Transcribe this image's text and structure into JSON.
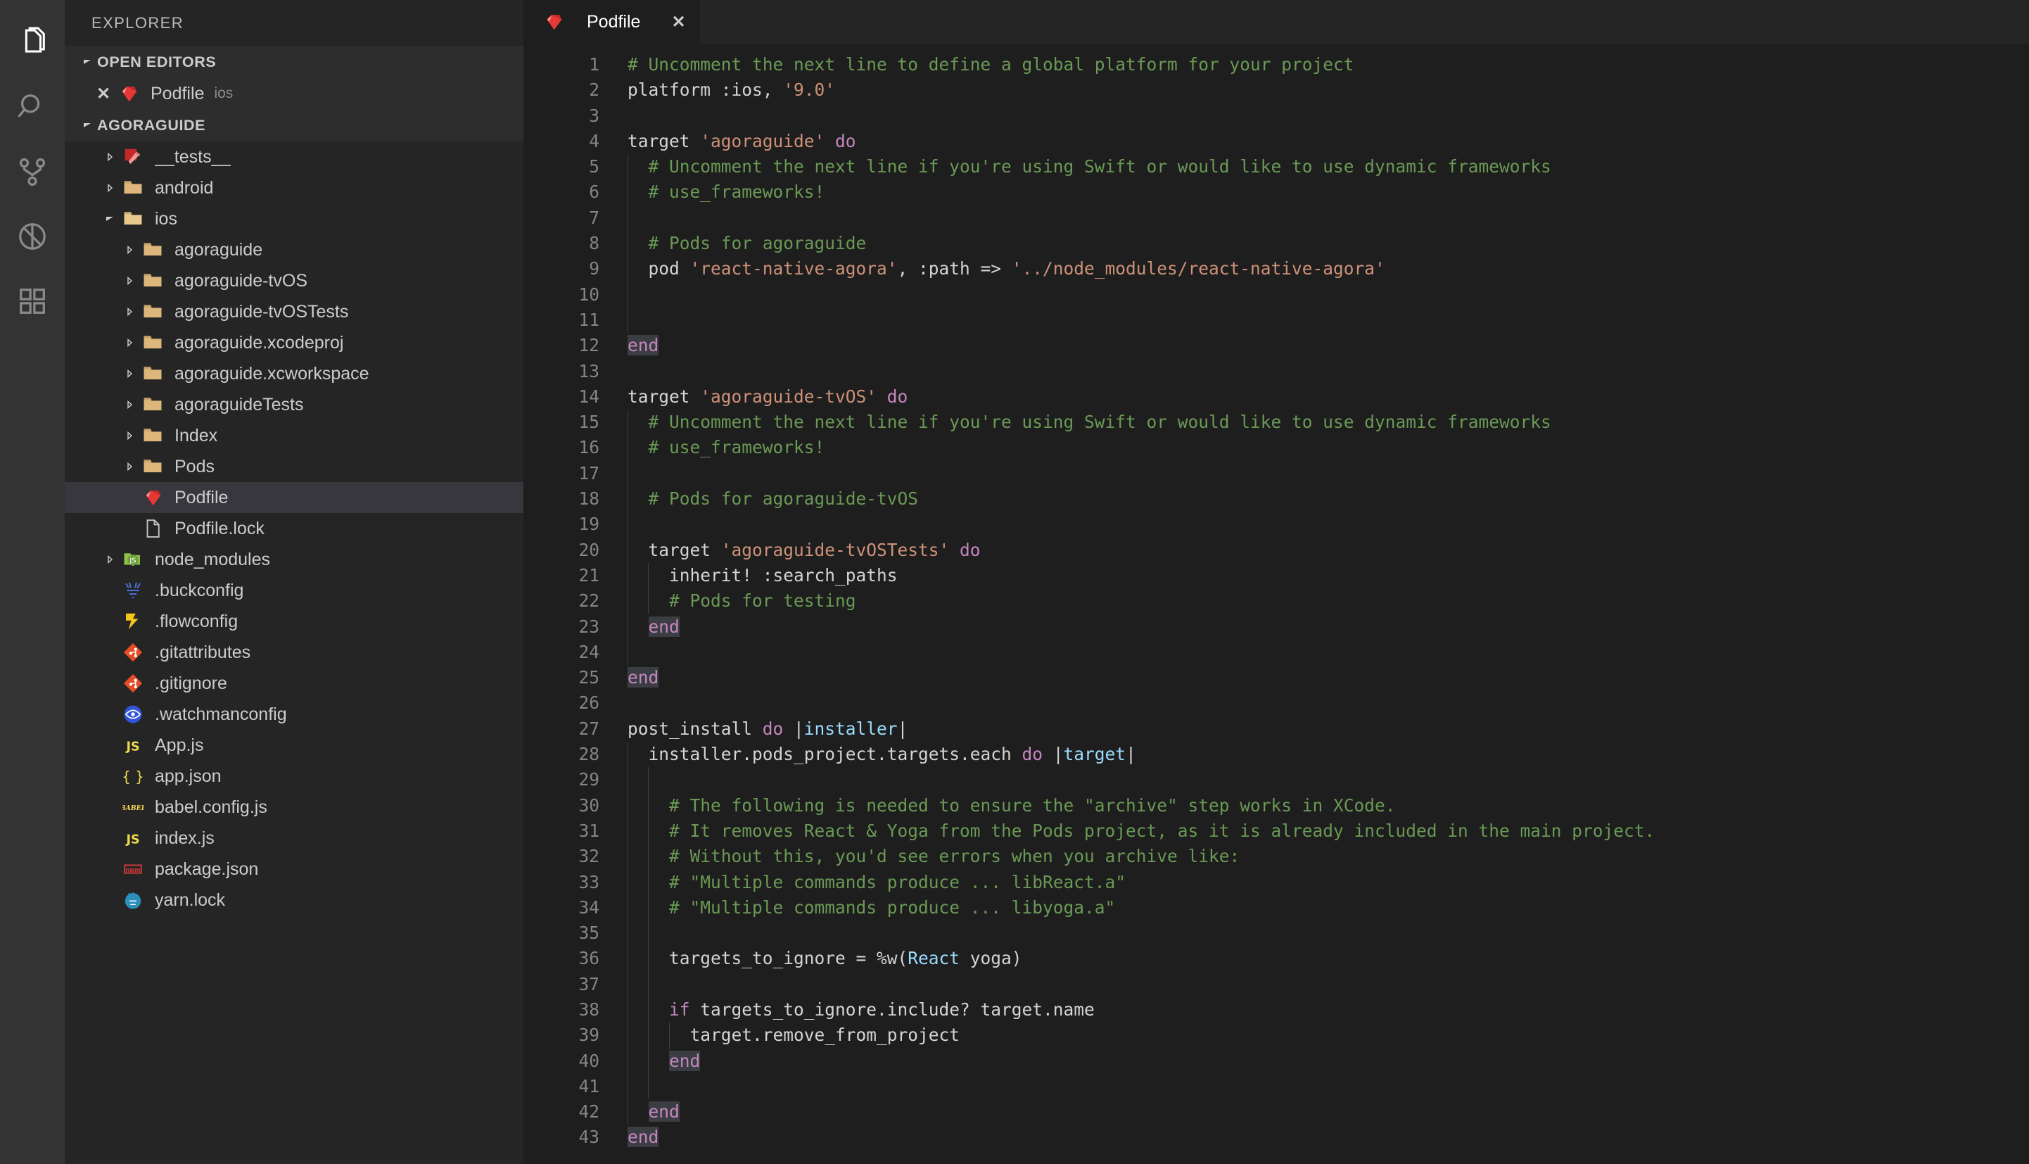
{
  "activity_bar": {
    "items": [
      {
        "name": "explorer",
        "icon": "files-icon",
        "active": true
      },
      {
        "name": "search",
        "icon": "search-icon",
        "active": false
      },
      {
        "name": "source-control",
        "icon": "source-control-icon",
        "active": false
      },
      {
        "name": "debug",
        "icon": "debug-icon",
        "active": false
      },
      {
        "name": "extensions",
        "icon": "extensions-icon",
        "active": false
      }
    ]
  },
  "sidebar": {
    "title": "EXPLORER",
    "open_editors": {
      "header": "OPEN EDITORS",
      "items": [
        {
          "label": "Podfile",
          "description": "ios",
          "icon": "ruby-icon",
          "close": "✕"
        }
      ]
    },
    "project": {
      "header": "AGORAGUIDE",
      "items": [
        {
          "label": "__tests__",
          "icon": "ruby-test-icon",
          "indent": 1,
          "twisty": "collapsed",
          "selected": false
        },
        {
          "label": "android",
          "icon": "folder-icon",
          "indent": 1,
          "twisty": "collapsed",
          "selected": false
        },
        {
          "label": "ios",
          "icon": "folder-open-icon",
          "indent": 1,
          "twisty": "expanded",
          "selected": false
        },
        {
          "label": "agoraguide",
          "icon": "folder-icon",
          "indent": 2,
          "twisty": "collapsed",
          "selected": false
        },
        {
          "label": "agoraguide-tvOS",
          "icon": "folder-icon",
          "indent": 2,
          "twisty": "collapsed",
          "selected": false
        },
        {
          "label": "agoraguide-tvOSTests",
          "icon": "folder-icon",
          "indent": 2,
          "twisty": "collapsed",
          "selected": false
        },
        {
          "label": "agoraguide.xcodeproj",
          "icon": "folder-icon",
          "indent": 2,
          "twisty": "collapsed",
          "selected": false
        },
        {
          "label": "agoraguide.xcworkspace",
          "icon": "folder-icon",
          "indent": 2,
          "twisty": "collapsed",
          "selected": false
        },
        {
          "label": "agoraguideTests",
          "icon": "folder-icon",
          "indent": 2,
          "twisty": "collapsed",
          "selected": false
        },
        {
          "label": "Index",
          "icon": "folder-icon",
          "indent": 2,
          "twisty": "collapsed",
          "selected": false
        },
        {
          "label": "Pods",
          "icon": "folder-icon",
          "indent": 2,
          "twisty": "collapsed",
          "selected": false
        },
        {
          "label": "Podfile",
          "icon": "ruby-icon",
          "indent": 2,
          "twisty": "none",
          "selected": true
        },
        {
          "label": "Podfile.lock",
          "icon": "file-icon",
          "indent": 2,
          "twisty": "none",
          "selected": false
        },
        {
          "label": "node_modules",
          "icon": "nodejs-icon",
          "indent": 1,
          "twisty": "collapsed",
          "selected": false
        },
        {
          "label": ".buckconfig",
          "icon": "buck-icon",
          "indent": 1,
          "twisty": "none",
          "selected": false
        },
        {
          "label": ".flowconfig",
          "icon": "flow-icon",
          "indent": 1,
          "twisty": "none",
          "selected": false
        },
        {
          "label": ".gitattributes",
          "icon": "git-icon",
          "indent": 1,
          "twisty": "none",
          "selected": false
        },
        {
          "label": ".gitignore",
          "icon": "git-icon",
          "indent": 1,
          "twisty": "none",
          "selected": false
        },
        {
          "label": ".watchmanconfig",
          "icon": "watchman-icon",
          "indent": 1,
          "twisty": "none",
          "selected": false
        },
        {
          "label": "App.js",
          "icon": "js-icon",
          "indent": 1,
          "twisty": "none",
          "selected": false
        },
        {
          "label": "app.json",
          "icon": "json-icon",
          "indent": 1,
          "twisty": "none",
          "selected": false
        },
        {
          "label": "babel.config.js",
          "icon": "babel-icon",
          "indent": 1,
          "twisty": "none",
          "selected": false
        },
        {
          "label": "index.js",
          "icon": "js-icon",
          "indent": 1,
          "twisty": "none",
          "selected": false
        },
        {
          "label": "package.json",
          "icon": "npm-icon",
          "indent": 1,
          "twisty": "none",
          "selected": false
        },
        {
          "label": "yarn.lock",
          "icon": "yarn-icon",
          "indent": 1,
          "twisty": "none",
          "selected": false
        }
      ]
    }
  },
  "editor": {
    "tabs": [
      {
        "label": "Podfile",
        "icon": "ruby-icon",
        "close": "✕",
        "active": true
      }
    ],
    "line_numbers": [
      1,
      2,
      3,
      4,
      5,
      6,
      7,
      8,
      9,
      10,
      11,
      12,
      13,
      14,
      15,
      16,
      17,
      18,
      19,
      20,
      21,
      22,
      23,
      24,
      25,
      26,
      27,
      28,
      29,
      30,
      31,
      32,
      33,
      34,
      35,
      36,
      37,
      38,
      39,
      40,
      41,
      42,
      43
    ],
    "language": "ruby",
    "lines": [
      {
        "n": 1,
        "indent": 0,
        "tokens": [
          {
            "t": "# Uncomment the next line to define a global platform for your project",
            "c": "cm"
          }
        ]
      },
      {
        "n": 2,
        "indent": 0,
        "tokens": [
          {
            "t": "platform :ios, ",
            "c": "plain"
          },
          {
            "t": "'9.0'",
            "c": "st"
          }
        ]
      },
      {
        "n": 3,
        "indent": 0,
        "tokens": []
      },
      {
        "n": 4,
        "indent": 0,
        "tokens": [
          {
            "t": "target ",
            "c": "plain"
          },
          {
            "t": "'agoraguide'",
            "c": "st"
          },
          {
            "t": " ",
            "c": "plain"
          },
          {
            "t": "do",
            "c": "kw"
          }
        ]
      },
      {
        "n": 5,
        "indent": 1,
        "tokens": [
          {
            "t": "  # Uncomment the next line if you're using Swift or would like to use dynamic frameworks",
            "c": "cm"
          }
        ]
      },
      {
        "n": 6,
        "indent": 1,
        "tokens": [
          {
            "t": "  # use_frameworks!",
            "c": "cm"
          }
        ]
      },
      {
        "n": 7,
        "indent": 1,
        "tokens": []
      },
      {
        "n": 8,
        "indent": 1,
        "tokens": [
          {
            "t": "  # Pods for agoraguide",
            "c": "cm"
          }
        ]
      },
      {
        "n": 9,
        "indent": 1,
        "tokens": [
          {
            "t": "  pod ",
            "c": "plain"
          },
          {
            "t": "'react-native-agora'",
            "c": "st"
          },
          {
            "t": ", :path => ",
            "c": "plain"
          },
          {
            "t": "'../node_modules/react-native-agora'",
            "c": "st"
          }
        ]
      },
      {
        "n": 10,
        "indent": 1,
        "tokens": []
      },
      {
        "n": 11,
        "indent": 1,
        "tokens": []
      },
      {
        "n": 12,
        "indent": 0,
        "tokens": [
          {
            "t": "end",
            "c": "kw endbox"
          }
        ]
      },
      {
        "n": 13,
        "indent": 0,
        "tokens": []
      },
      {
        "n": 14,
        "indent": 0,
        "tokens": [
          {
            "t": "target ",
            "c": "plain"
          },
          {
            "t": "'agoraguide-tvOS'",
            "c": "st"
          },
          {
            "t": " ",
            "c": "plain"
          },
          {
            "t": "do",
            "c": "kw"
          }
        ]
      },
      {
        "n": 15,
        "indent": 1,
        "tokens": [
          {
            "t": "  # Uncomment the next line if you're using Swift or would like to use dynamic frameworks",
            "c": "cm"
          }
        ]
      },
      {
        "n": 16,
        "indent": 1,
        "tokens": [
          {
            "t": "  # use_frameworks!",
            "c": "cm"
          }
        ]
      },
      {
        "n": 17,
        "indent": 1,
        "tokens": []
      },
      {
        "n": 18,
        "indent": 1,
        "tokens": [
          {
            "t": "  # Pods for agoraguide-tvOS",
            "c": "cm"
          }
        ]
      },
      {
        "n": 19,
        "indent": 1,
        "tokens": []
      },
      {
        "n": 20,
        "indent": 1,
        "tokens": [
          {
            "t": "  target ",
            "c": "plain"
          },
          {
            "t": "'agoraguide-tvOSTests'",
            "c": "st"
          },
          {
            "t": " ",
            "c": "plain"
          },
          {
            "t": "do",
            "c": "kw"
          }
        ]
      },
      {
        "n": 21,
        "indent": 2,
        "tokens": [
          {
            "t": "    inherit! :search_paths",
            "c": "plain"
          }
        ]
      },
      {
        "n": 22,
        "indent": 2,
        "tokens": [
          {
            "t": "    # Pods for testing",
            "c": "cm"
          }
        ]
      },
      {
        "n": 23,
        "indent": 1,
        "tokens": [
          {
            "t": "  ",
            "c": "plain"
          },
          {
            "t": "end",
            "c": "kw endbox"
          }
        ]
      },
      {
        "n": 24,
        "indent": 1,
        "tokens": []
      },
      {
        "n": 25,
        "indent": 0,
        "tokens": [
          {
            "t": "end",
            "c": "kw endbox"
          }
        ]
      },
      {
        "n": 26,
        "indent": 0,
        "tokens": []
      },
      {
        "n": 27,
        "indent": 0,
        "tokens": [
          {
            "t": "post_install ",
            "c": "plain"
          },
          {
            "t": "do",
            "c": "kw"
          },
          {
            "t": " |",
            "c": "plain"
          },
          {
            "t": "installer",
            "c": "bv"
          },
          {
            "t": "|",
            "c": "plain"
          }
        ]
      },
      {
        "n": 28,
        "indent": 1,
        "tokens": [
          {
            "t": "  installer.pods_project.targets.each ",
            "c": "plain"
          },
          {
            "t": "do",
            "c": "kw"
          },
          {
            "t": " |",
            "c": "plain"
          },
          {
            "t": "target",
            "c": "bv"
          },
          {
            "t": "|",
            "c": "plain"
          }
        ]
      },
      {
        "n": 29,
        "indent": 2,
        "tokens": []
      },
      {
        "n": 30,
        "indent": 2,
        "tokens": [
          {
            "t": "    # The following is needed to ensure the \"archive\" step works in XCode.",
            "c": "cm"
          }
        ]
      },
      {
        "n": 31,
        "indent": 2,
        "tokens": [
          {
            "t": "    # It removes React & Yoga from the Pods project, as it is already included in the main project.",
            "c": "cm"
          }
        ]
      },
      {
        "n": 32,
        "indent": 2,
        "tokens": [
          {
            "t": "    # Without this, you'd see errors when you archive like:",
            "c": "cm"
          }
        ]
      },
      {
        "n": 33,
        "indent": 2,
        "tokens": [
          {
            "t": "    # \"Multiple commands produce ... libReact.a\"",
            "c": "cm"
          }
        ]
      },
      {
        "n": 34,
        "indent": 2,
        "tokens": [
          {
            "t": "    # \"Multiple commands produce ... libyoga.a\"",
            "c": "cm"
          }
        ]
      },
      {
        "n": 35,
        "indent": 2,
        "tokens": []
      },
      {
        "n": 36,
        "indent": 2,
        "tokens": [
          {
            "t": "    targets_to_ignore = %w(",
            "c": "plain"
          },
          {
            "t": "React",
            "c": "blue"
          },
          {
            "t": " yoga)",
            "c": "plain"
          }
        ]
      },
      {
        "n": 37,
        "indent": 2,
        "tokens": []
      },
      {
        "n": 38,
        "indent": 2,
        "tokens": [
          {
            "t": "    ",
            "c": "plain"
          },
          {
            "t": "if",
            "c": "kw"
          },
          {
            "t": " targets_to_ignore.include? target.name",
            "c": "plain"
          }
        ]
      },
      {
        "n": 39,
        "indent": 3,
        "tokens": [
          {
            "t": "      target.remove_from_project",
            "c": "plain"
          }
        ]
      },
      {
        "n": 40,
        "indent": 2,
        "tokens": [
          {
            "t": "    ",
            "c": "plain"
          },
          {
            "t": "end",
            "c": "kw endbox"
          }
        ]
      },
      {
        "n": 41,
        "indent": 2,
        "tokens": []
      },
      {
        "n": 42,
        "indent": 1,
        "tokens": [
          {
            "t": "  ",
            "c": "plain"
          },
          {
            "t": "end",
            "c": "kw endbox"
          }
        ]
      },
      {
        "n": 43,
        "indent": 0,
        "tokens": [
          {
            "t": "end",
            "c": "kw endbox"
          }
        ]
      }
    ]
  },
  "colors": {
    "editor_background": "#1e1e1e",
    "sidebar_background": "#252526",
    "activity_bar_background": "#333333",
    "selection_row": "#37373d",
    "comment": "#6a9955",
    "string": "#ce9178",
    "keyword": "#c586c0",
    "variable": "#9cdcfe",
    "foreground": "#d4d4d4",
    "line_number": "#858585",
    "folder": "#dcb67a",
    "ruby": "#d0302f"
  }
}
